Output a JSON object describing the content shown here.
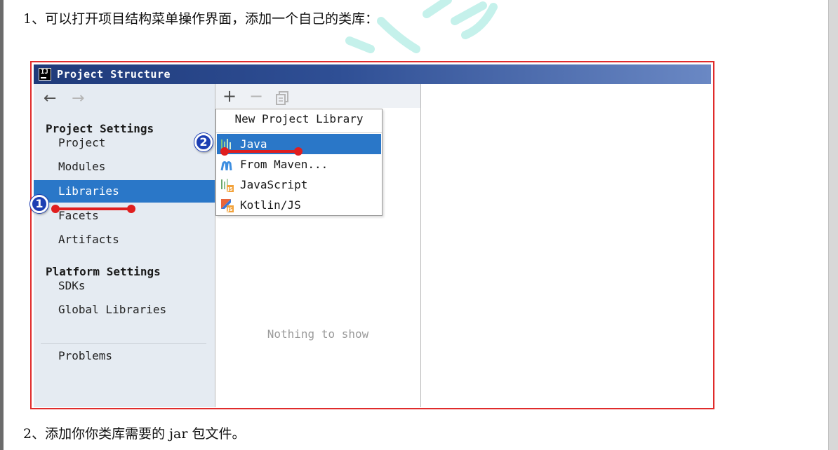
{
  "document": {
    "step1_text": "1、可以打开项目结构菜单操作界面，添加一个自己的类库：",
    "step2_text": "2、添加你你类库需要的 jar 包文件。"
  },
  "window": {
    "title": "Project Structure",
    "app_icon_label": "IJ"
  },
  "sidebar": {
    "back_icon": "←",
    "forward_icon": "→",
    "project_settings_heading": "Project Settings",
    "items": [
      {
        "label": "Project",
        "selected": false
      },
      {
        "label": "Modules",
        "selected": false
      },
      {
        "label": "Libraries",
        "selected": true
      },
      {
        "label": "Facets",
        "selected": false
      },
      {
        "label": "Artifacts",
        "selected": false
      }
    ],
    "platform_settings_heading": "Platform Settings",
    "platform_items": [
      {
        "label": "SDKs"
      },
      {
        "label": "Global Libraries"
      }
    ],
    "problems_label": "Problems"
  },
  "toolbar": {
    "add_symbol": "+",
    "remove_symbol": "−",
    "copy_icon": "copy-icon"
  },
  "middle": {
    "empty_text": "Nothing to show"
  },
  "popup": {
    "title": "New Project Library",
    "items": [
      {
        "label": "Java",
        "icon": "java-library-icon",
        "selected": true
      },
      {
        "label": "From Maven...",
        "icon": "maven-icon",
        "selected": false
      },
      {
        "label": "JavaScript",
        "icon": "javascript-library-icon",
        "selected": false
      },
      {
        "label": "Kotlin/JS",
        "icon": "kotlin-js-icon",
        "selected": false
      }
    ]
  },
  "annotations": {
    "marker1": "1",
    "marker2": "2",
    "marker_color": "#1d3fb3",
    "underline_color": "#e01e1e"
  },
  "colors": {
    "selection": "#2a77c8",
    "frame_border": "#e02b2b",
    "titlebar_start": "#1f3a7a",
    "titlebar_end": "#6a88c4"
  }
}
